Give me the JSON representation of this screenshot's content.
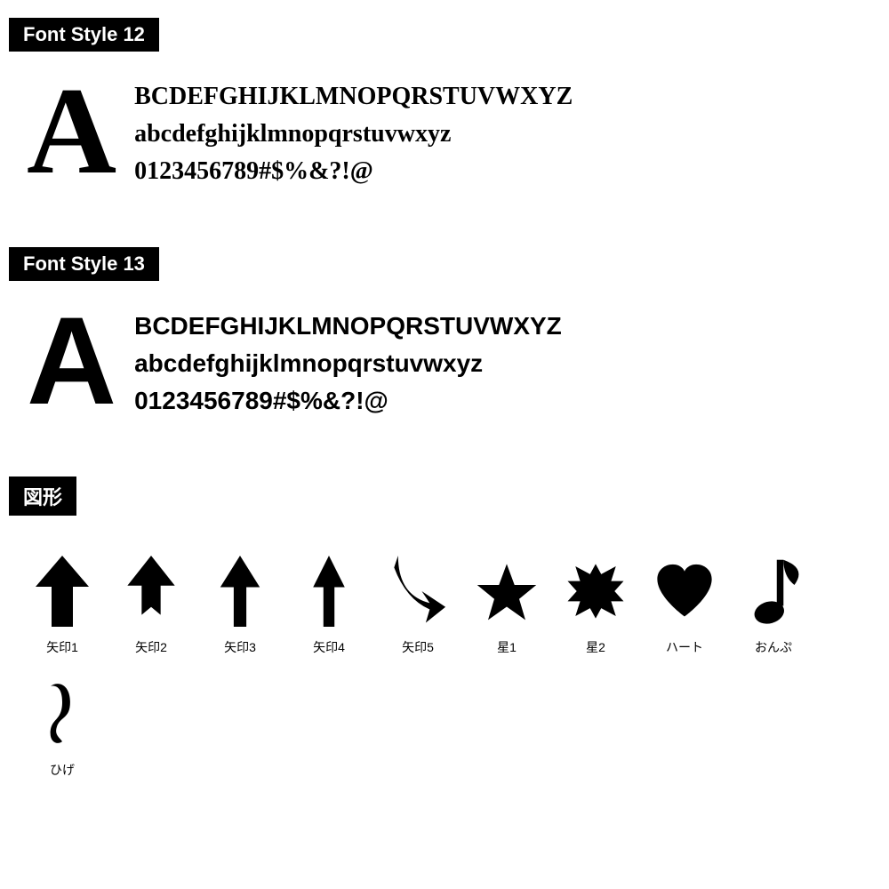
{
  "fontStyle12": {
    "label": "Font Style 12",
    "bigLetter": "A",
    "lines": [
      "BCDEFGHIJKLMNOPQRSTUVWXYZ",
      "abcdefghijklmnopqrstuvwxyz",
      "0123456789#$%&?!@"
    ]
  },
  "fontStyle13": {
    "label": "Font Style 13",
    "bigLetter": "A",
    "lines": [
      "BCDEFGHIJKLMNOPQRSTUVWXYZ",
      "abcdefghijklmnopqrstuvwxyz",
      "0123456789#$%&?!@"
    ]
  },
  "shapes": {
    "label": "図形",
    "items": [
      {
        "name": "矢印1",
        "type": "arrow1"
      },
      {
        "name": "矢印2",
        "type": "arrow2"
      },
      {
        "name": "矢印3",
        "type": "arrow3"
      },
      {
        "name": "矢印4",
        "type": "arrow4"
      },
      {
        "name": "矢印5",
        "type": "arrow5"
      },
      {
        "name": "星1",
        "type": "star1"
      },
      {
        "name": "星2",
        "type": "star2"
      },
      {
        "name": "ハート",
        "type": "heart"
      },
      {
        "name": "おんぷ",
        "type": "note"
      },
      {
        "name": "ひげ",
        "type": "mustache"
      }
    ]
  }
}
